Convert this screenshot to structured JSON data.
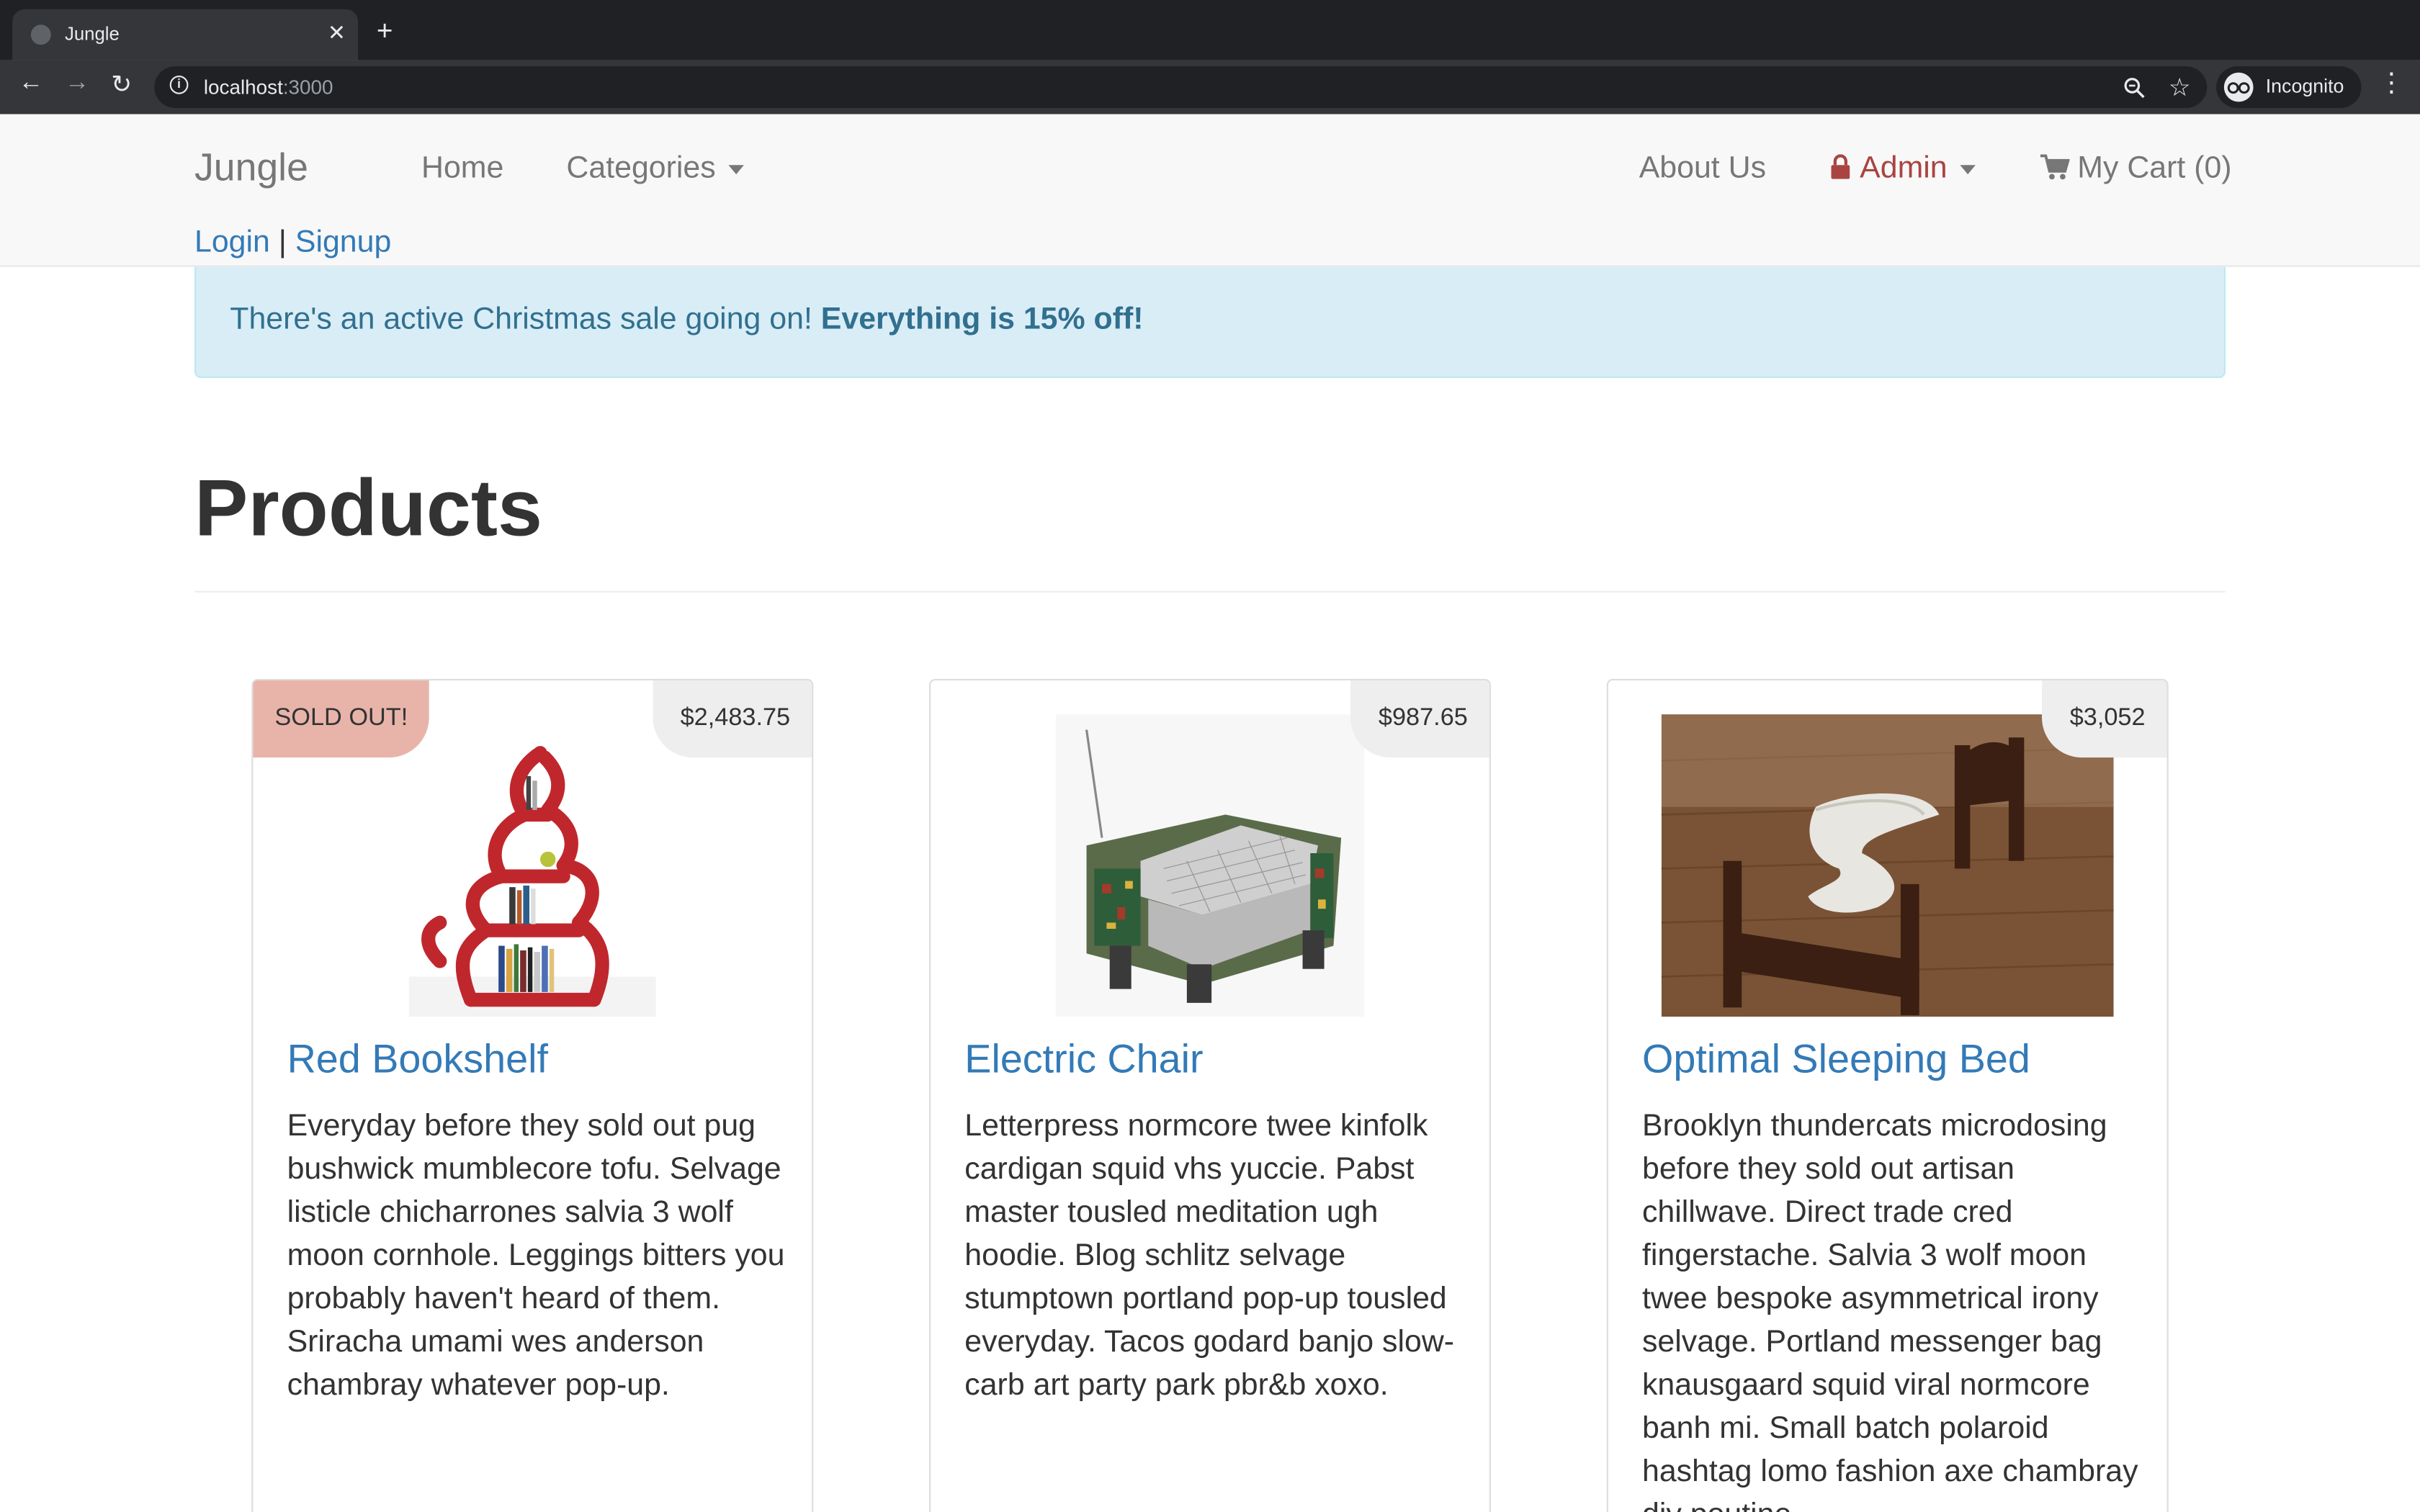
{
  "browser": {
    "tab_title": "Jungle",
    "url_host": "localhost",
    "url_port": ":3000",
    "profile": "Incognito"
  },
  "navbar": {
    "brand": "Jungle",
    "home": "Home",
    "categories": "Categories",
    "about": "About Us",
    "admin": "Admin",
    "cart": "My Cart (0)",
    "login": "Login",
    "separator": "|",
    "signup": "Signup"
  },
  "alert": {
    "text": "There's an active Christmas sale going on!",
    "bold": "Everything is 15% off!"
  },
  "page_title": "Products",
  "products": [
    {
      "name": "Red Bookshelf",
      "price": "$2,483.75",
      "badge": "SOLD OUT!",
      "description": "Everyday before they sold out pug bushwick mumblecore tofu. Selvage listicle chicharrones salvia 3 wolf moon cornhole. Leggings bitters you probably haven't heard of them. Sriracha umami wes anderson chambray whatever pop-up."
    },
    {
      "name": "Electric Chair",
      "price": "$987.65",
      "description": "Letterpress normcore twee kinfolk cardigan squid vhs yuccie. Pabst master tousled meditation ugh hoodie. Blog schlitz selvage stumptown portland pop-up tousled everyday. Tacos godard banjo slow-carb art party park pbr&b xoxo."
    },
    {
      "name": "Optimal Sleeping Bed",
      "price": "$3,052",
      "description": "Brooklyn thundercats microdosing before they sold out artisan chillwave. Direct trade cred fingerstache. Salvia 3 wolf moon twee bespoke asymmetrical irony selvage. Portland messenger bag knausgaard squid viral normcore banh mi. Small batch polaroid hashtag lomo fashion axe chambray diy poutine."
    }
  ],
  "colors": {
    "link": "#337ab7",
    "admin": "#a94442",
    "alert_bg": "#d9edf7",
    "alert_text": "#31708f",
    "soldout_bg": "#e8b4aa"
  }
}
